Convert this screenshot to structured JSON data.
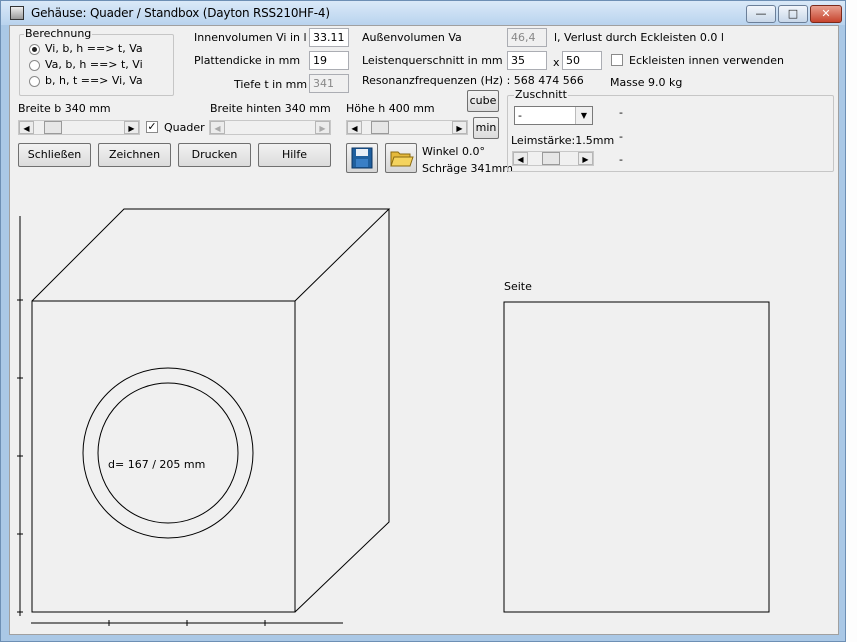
{
  "window": {
    "title": "Gehäuse: Quader / Standbox (Dayton RSS210HF-4)",
    "minimize": "—",
    "maximize": "□",
    "close": "✕"
  },
  "berechnung": {
    "label": "Berechnung",
    "options": [
      {
        "label": "Vi, b, h ==>  t, Va",
        "selected": true
      },
      {
        "label": "Va, b, h ==> t, Vi",
        "selected": false
      },
      {
        "label": "b, h, t ==> Vi, Va",
        "selected": false
      }
    ]
  },
  "params": {
    "innenvolumen_label": "Innenvolumen Vi in l",
    "innenvolumen_value": "33.11",
    "plattendicke_label": "Plattendicke in mm",
    "plattendicke_value": "19",
    "tiefe_label": "Tiefe t in mm",
    "tiefe_value": "341",
    "aussenvolumen_label": "Außenvolumen Va",
    "aussenvolumen_value": "46,4",
    "verlust_text": "l, Verlust durch Eckleisten 0.0 l",
    "leisten_label": "Leistenquerschnitt in mm",
    "leisten_w": "35",
    "leisten_x": "x",
    "leisten_h": "50",
    "eckleisten_label": "Eckleisten innen verwenden",
    "eckleisten_checked": false,
    "resonanz_text": "Resonanzfrequenzen (Hz) : 568  474  566",
    "masse_text": "Masse 9.0 kg"
  },
  "sliders": {
    "breite_label": "Breite b 340 mm",
    "breite_hinten_label": "Breite hinten 340 mm",
    "hoehe_label": "Höhe h 400 mm",
    "quader_label": "Quader",
    "quader_checked": true,
    "breite_level": 0.14,
    "breite_hinten_level": 0.0,
    "hoehe_level": 0.12
  },
  "buttons": {
    "cube": "cube",
    "min": "min",
    "schliessen": "Schließen",
    "zeichnen": "Zeichnen",
    "drucken": "Drucken",
    "hilfe": "Hilfe"
  },
  "angle": {
    "winkel": "Winkel 0.0°",
    "schraege": "Schräge 341mm"
  },
  "zuschnitt": {
    "label": "Zuschnitt",
    "selected": "-",
    "leimstaerke": "Leimstärke:1.5mm",
    "leim_level": 0.45,
    "dash1": "-",
    "dash2": "-",
    "dash3": "-"
  },
  "drawing": {
    "diameter_text": "d= 167 / 205 mm",
    "seite_label": "Seite"
  },
  "colors": {
    "window_frame": "#aac8e6",
    "client_bg": "#f0f0f0",
    "close_red": "#c7442e"
  },
  "icons": {
    "save": "floppy-disk-icon",
    "open": "open-folder-icon"
  }
}
